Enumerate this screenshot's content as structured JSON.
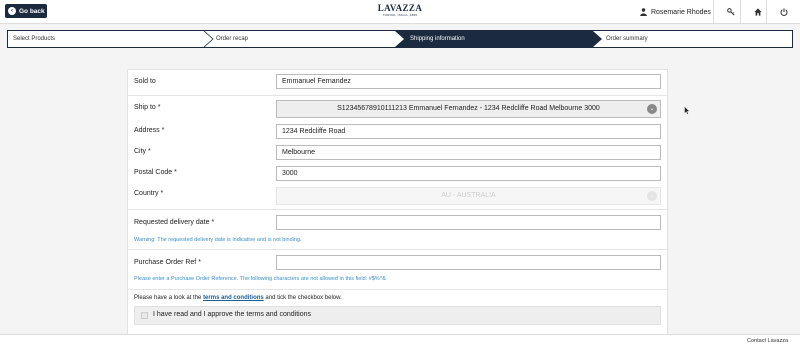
{
  "header": {
    "back_label": "Go back",
    "logo_text": "LAVAZZA",
    "logo_subtext": "TORINO, ITALIA, 1895",
    "user_name": "Rosemarie Rhodes"
  },
  "steps": [
    {
      "label": "Select Products"
    },
    {
      "label": "Order recap"
    },
    {
      "label": "Shipping information"
    },
    {
      "label": "Order summary"
    }
  ],
  "form": {
    "sold_to_label": "Sold to",
    "sold_to_value": "Emmanuel Fernandez",
    "ship_to_label": "Ship to *",
    "ship_to_value": "S12345678910111213 Emmanuel Fernandez - 1234 Redcliffe Road Melbourne 3000",
    "address_label": "Address *",
    "address_value": "1234 Redcliffe Road",
    "city_label": "City *",
    "city_value": "Melbourne",
    "postal_label": "Postal Code *",
    "postal_value": "3000",
    "country_label": "Country *",
    "country_value": "AU - AUSTRALIA",
    "delivery_label": "Requested delivery date *",
    "delivery_value": "",
    "delivery_warning": "Warning: The requested delivery date is indicative and is not binding.",
    "po_label": "Purchase Order Ref *",
    "po_value": "",
    "po_hint": "Please enter a Purchase Order Reference. The following characters are not allowed in this field: #$%^&",
    "terms_prefix": "Please have a look at the",
    "terms_link": "terms and conditions",
    "terms_suffix": "and tick the checkbox below.",
    "terms_checkbox_label": "I have read and I approve the terms and conditions"
  },
  "footer": {
    "contact_label": "Contact Lavazza"
  },
  "colors": {
    "navy": "#1b2a3f",
    "hint_blue": "#3a90c9"
  }
}
